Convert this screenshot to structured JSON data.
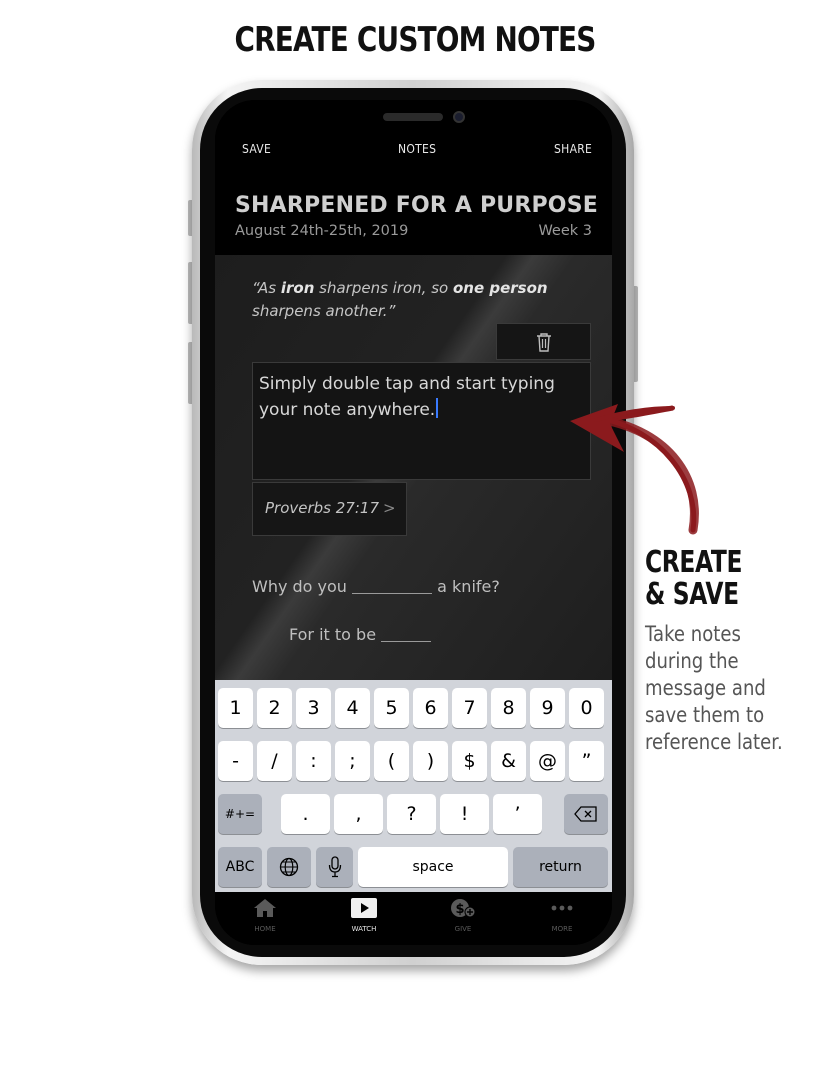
{
  "headline": "CREATE CUSTOM NOTES",
  "nav": {
    "save": "SAVE",
    "title": "NOTES",
    "share": "SHARE"
  },
  "sermon": {
    "title": "SHARPENED FOR A PURPOSE",
    "date": "August 24th-25th, 2019",
    "week": "Week 3"
  },
  "quote": {
    "p1": "“As ",
    "b1": "iron",
    "p2": " sharpens iron, so ",
    "b2": "one person",
    "p3": " sharpens another.”"
  },
  "note_text": "Simply double tap and start typing your note anywhere.",
  "verse": {
    "label": "Proverbs 27:17",
    "chevron": ">"
  },
  "fill_in_1": {
    "before": "Why do you",
    "after": "a knife?"
  },
  "fill_in_2": {
    "before": "For it to be"
  },
  "keyboard": {
    "row1": [
      "1",
      "2",
      "3",
      "4",
      "5",
      "6",
      "7",
      "8",
      "9",
      "0"
    ],
    "row2": [
      "-",
      "/",
      ":",
      ";",
      "(",
      ")",
      "$",
      "&",
      "@",
      "”"
    ],
    "row3_left": "#+=",
    "row3": [
      ".",
      ",",
      "?",
      "!",
      "’"
    ],
    "row4": {
      "abc": "ABC",
      "space": "space",
      "return": "return"
    }
  },
  "tabs": [
    {
      "label": "HOME",
      "icon": "home-icon"
    },
    {
      "label": "WATCH",
      "icon": "play-icon",
      "active": true
    },
    {
      "label": "GIVE",
      "icon": "give-icon"
    },
    {
      "label": "MORE",
      "icon": "more-icon"
    }
  ],
  "annotation": {
    "title_line1": "CREATE",
    "title_line2": "& SAVE",
    "body": "Take notes during the message and save them to reference later.",
    "arrow_color": "#8b1a1d"
  }
}
